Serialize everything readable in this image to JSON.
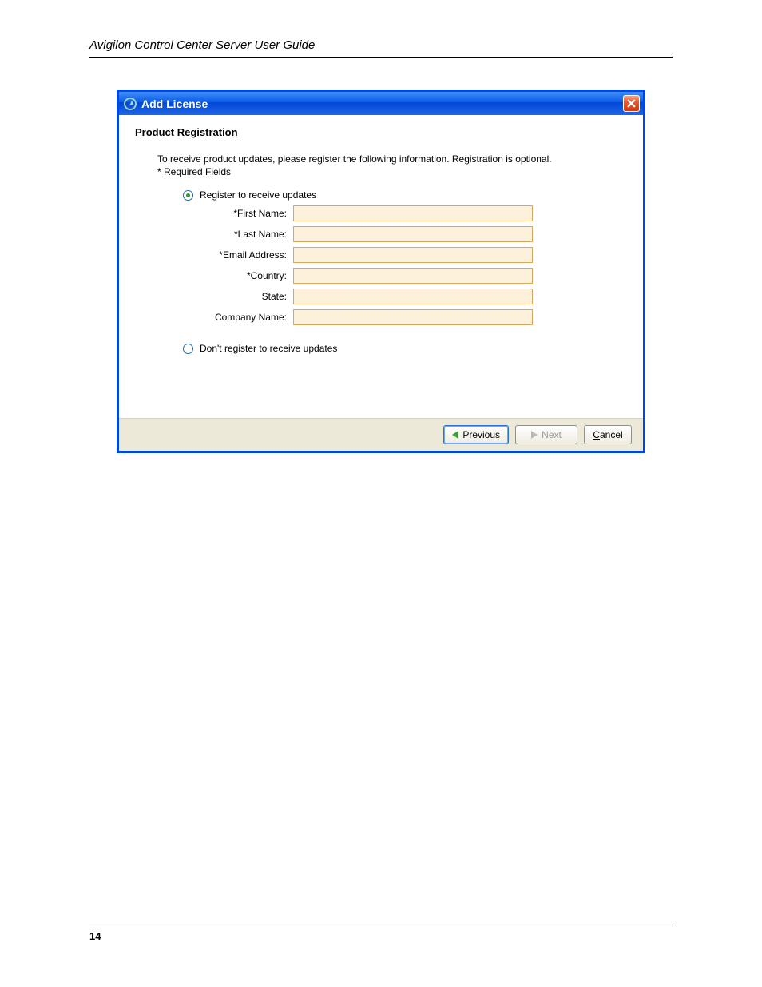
{
  "doc_header": "Avigilon Control Center Server User Guide",
  "page_number": "14",
  "dialog": {
    "title": "Add License",
    "section_title": "Product Registration",
    "intro_line1": "To receive product updates, please register the following information.  Registration is optional.",
    "intro_line2": "* Required Fields",
    "radio_register": "Register to receive updates",
    "radio_noregister": "Don't register to receive updates",
    "fields": {
      "first_name": "*First Name:",
      "last_name": "*Last Name:",
      "email": "*Email Address:",
      "country": "*Country:",
      "state": "State:",
      "company": "Company Name:"
    },
    "values": {
      "first_name": "",
      "last_name": "",
      "email": "",
      "country": "",
      "state": "",
      "company": ""
    },
    "buttons": {
      "previous": "Previous",
      "next": "Next",
      "cancel_prefix": "C",
      "cancel_rest": "ancel"
    }
  }
}
